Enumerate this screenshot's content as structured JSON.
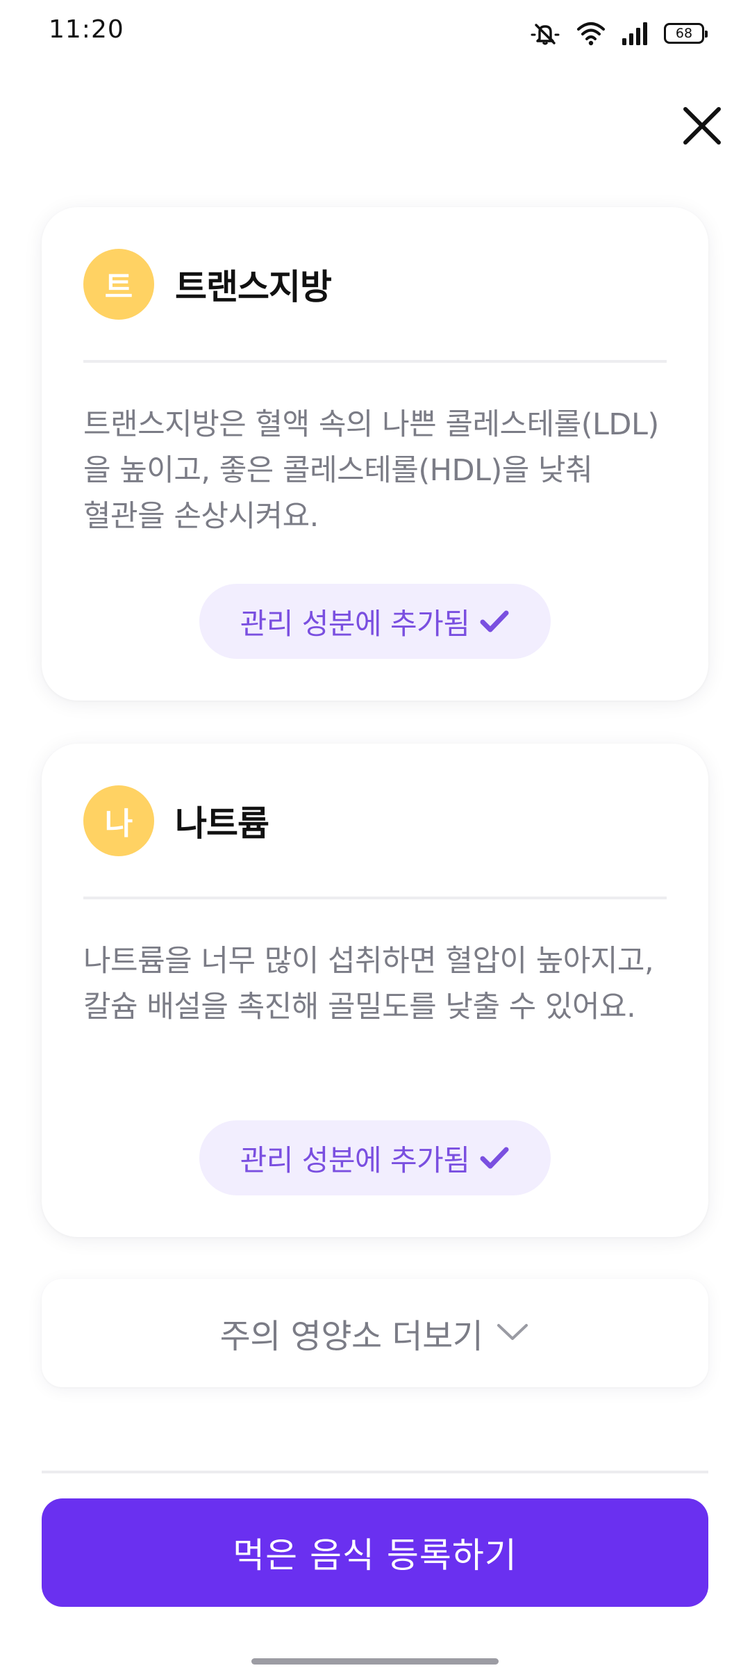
{
  "status_bar": {
    "time": "11:20",
    "battery_level": "68"
  },
  "header": {
    "close_icon": "close-icon"
  },
  "nutrients": [
    {
      "avatar_char": "트",
      "title": "트랜스지방",
      "description": "트랜스지방은 혈액 속의 나쁜 콜레스테롤(LDL)을 높이고, 좋은 콜레스테롤(HDL)을 낮춰 혈관을 손상시켜요.",
      "status_label": "관리 성분에 추가됨"
    },
    {
      "avatar_char": "나",
      "title": "나트륨",
      "description": "나트륨을 너무 많이 섭취하면 혈압이 높아지고, 칼슘 배설을 촉진해 골밀도를 낮출 수 있어요.",
      "status_label": "관리 성분에 추가됨"
    }
  ],
  "more_nutrients": {
    "label": "주의 영양소 더보기"
  },
  "primary_action": {
    "label": "먹은 음식 등록하기"
  },
  "colors": {
    "accent": "#6a30f0",
    "accent_text": "#7a4fe0",
    "pill_background": "#f2eefe",
    "avatar": "#ffd263",
    "description_text": "#7b7c86"
  }
}
